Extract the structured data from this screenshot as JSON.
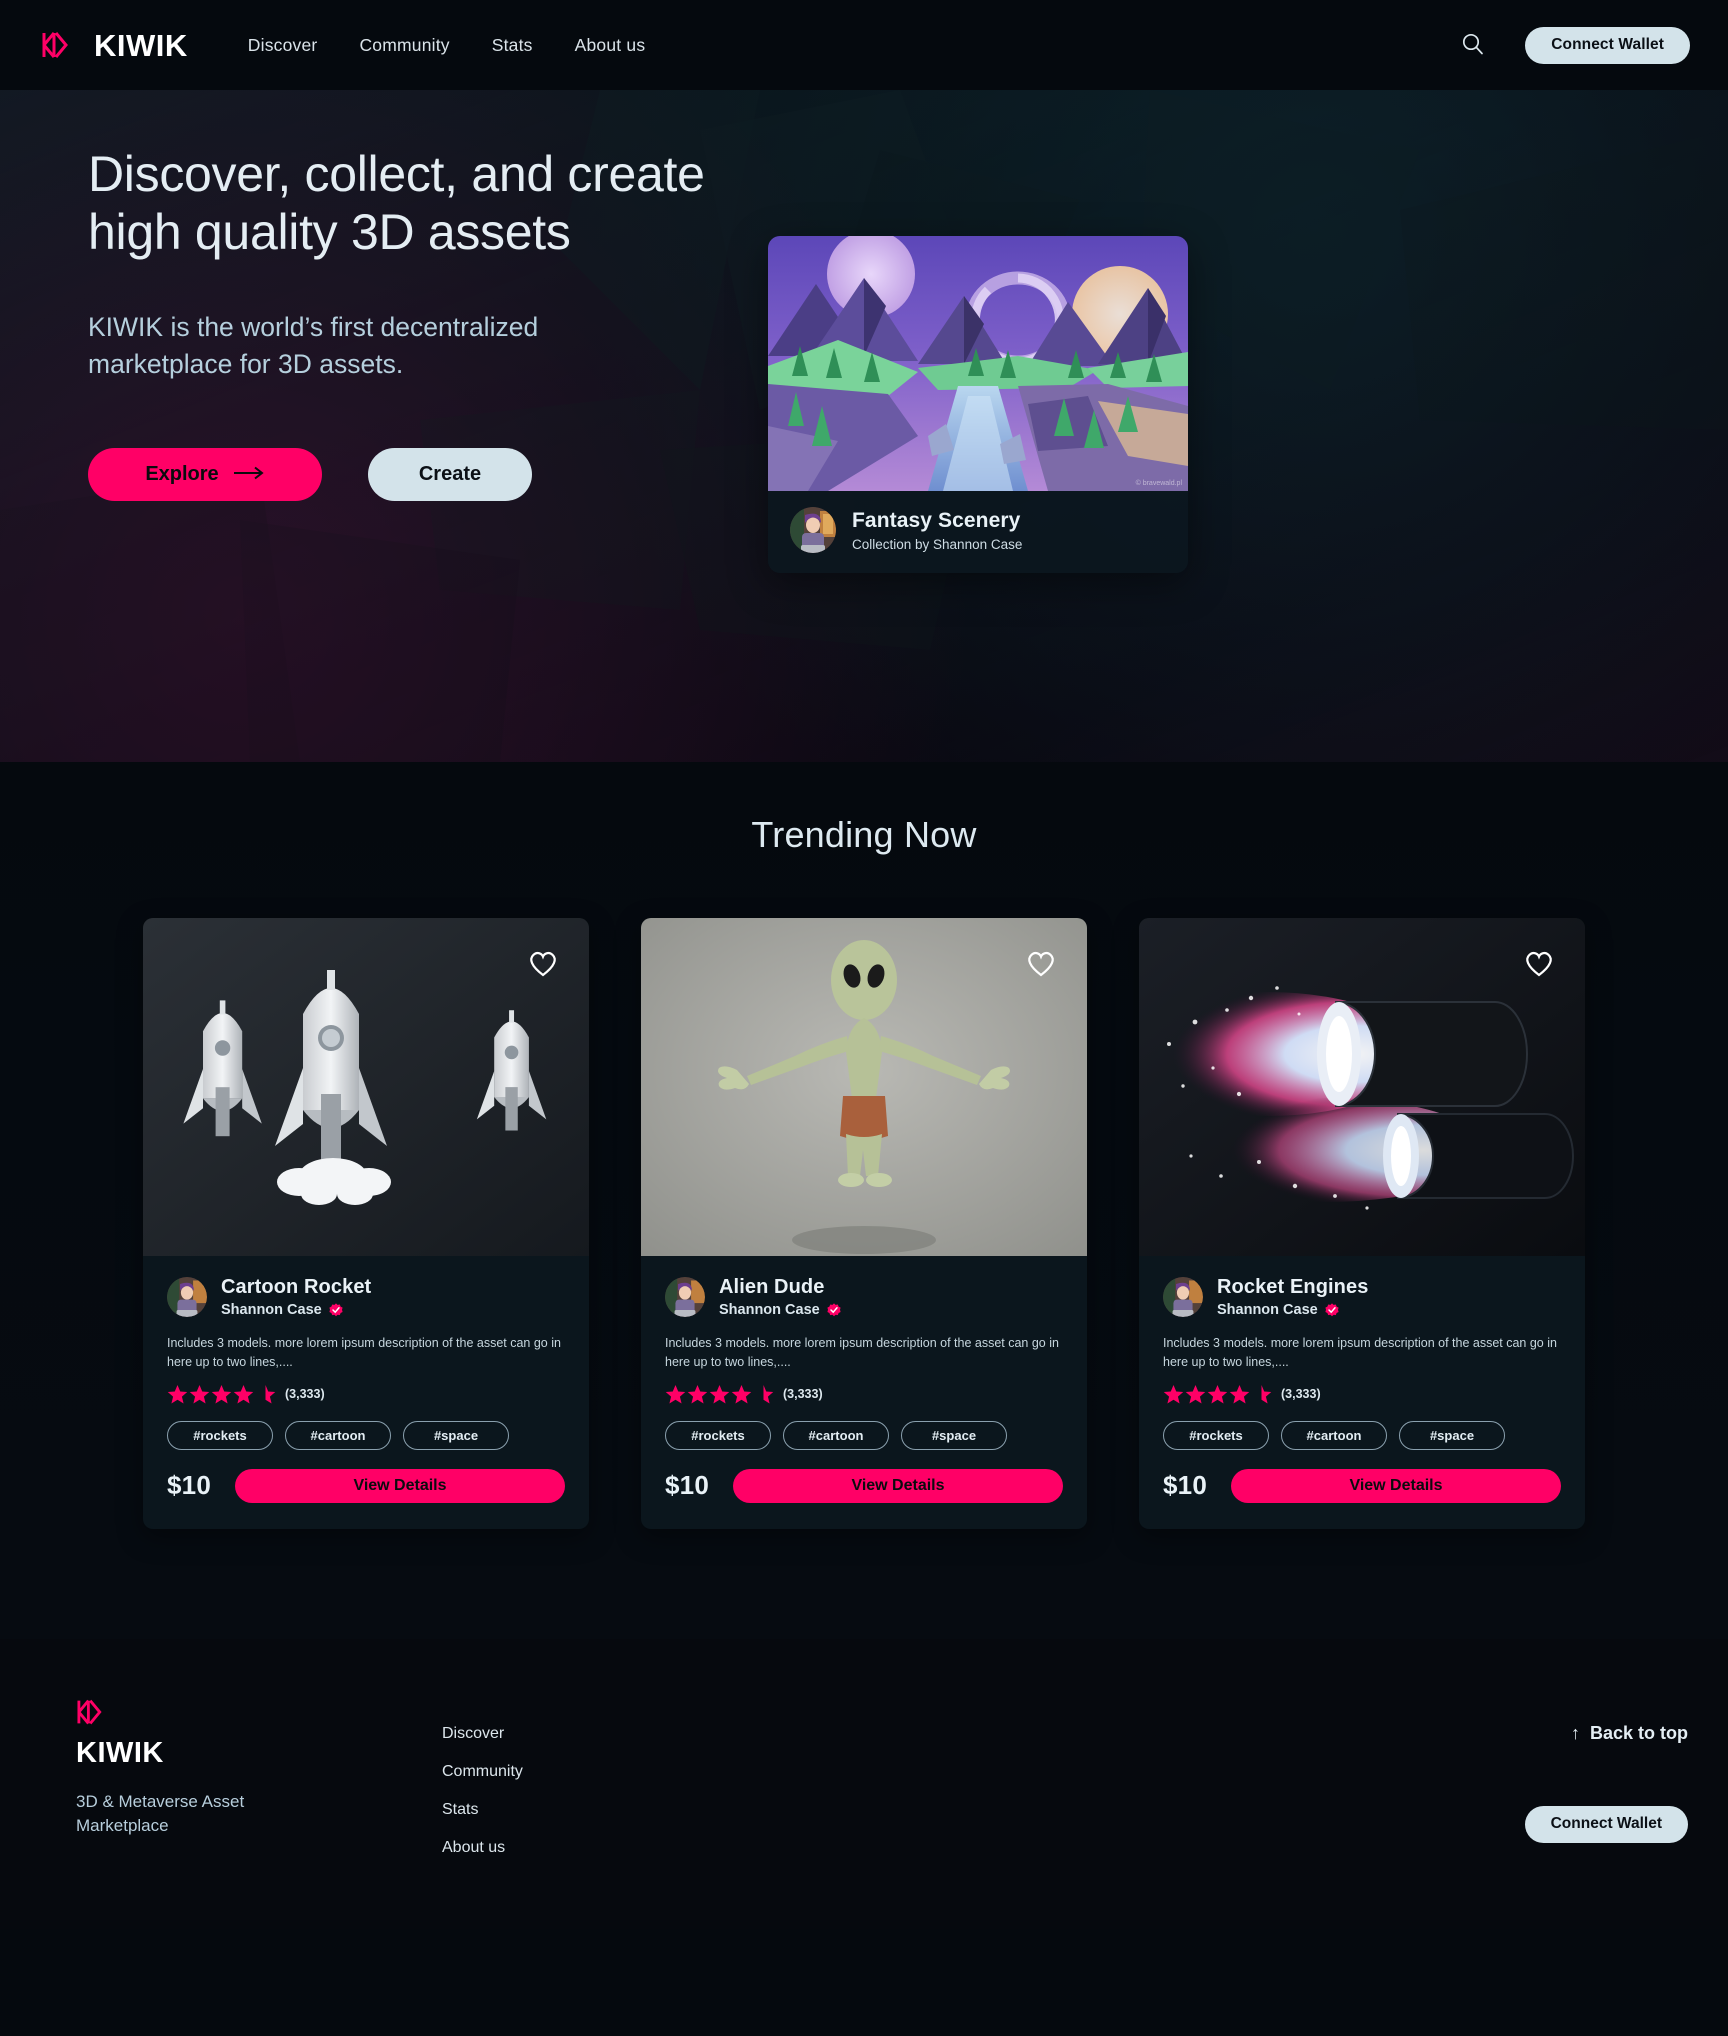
{
  "header": {
    "logo_word": "KIWIK",
    "logo_icon": "kiwik-logo-icon",
    "nav": [
      {
        "label": "Discover"
      },
      {
        "label": "Community"
      },
      {
        "label": "Stats"
      },
      {
        "label": "About us"
      }
    ],
    "search_icon": "search-icon",
    "wallet_label": "Connect Wallet"
  },
  "hero": {
    "title": "Discover, collect, and create high quality 3D assets",
    "subtitle": "KIWIK is the world’s first decentralized marketplace for 3D assets.",
    "primary_cta": "Explore",
    "primary_cta_arrow": "→",
    "secondary_cta": "Create",
    "feature": {
      "image_name": "fantasy-low-poly-landscape",
      "watermark": "© bravewald.pl",
      "title": "Fantasy Scenery",
      "subtitle": "Collection by Shannon Case",
      "avatar_name": "shannon-case-avatar"
    }
  },
  "trending": {
    "title": "Trending Now",
    "cards": [
      {
        "image_name": "cartoon-rocket-render",
        "title": "Cartoon Rocket",
        "author": "Shannon Case",
        "verified": true,
        "description": "Includes 3 models. more lorem ipsum description of the asset can go in here up to two lines,....",
        "rating": 4.5,
        "rating_count": "(3,333)",
        "tags": [
          "#rockets",
          "#cartoon",
          "#space"
        ],
        "price": "$10",
        "cta": "View Details",
        "like_icon": "heart-icon"
      },
      {
        "image_name": "alien-dude-render",
        "title": "Alien Dude",
        "author": "Shannon Case",
        "verified": true,
        "description": "Includes 3 models. more lorem ipsum description of the asset can go in here up to two lines,....",
        "rating": 4.5,
        "rating_count": "(3,333)",
        "tags": [
          "#rockets",
          "#cartoon",
          "#space"
        ],
        "price": "$10",
        "cta": "View Details",
        "like_icon": "heart-icon"
      },
      {
        "image_name": "rocket-engines-render",
        "title": "Rocket Engines",
        "author": "Shannon Case",
        "verified": true,
        "description": "Includes 3 models. more lorem ipsum description of the asset can go in here up to two lines,....",
        "rating": 4.5,
        "rating_count": "(3,333)",
        "tags": [
          "#rockets",
          "#cartoon",
          "#space"
        ],
        "price": "$10",
        "cta": "View Details",
        "like_icon": "heart-icon"
      }
    ]
  },
  "footer": {
    "logo_word": "KIWIK",
    "tagline": "3D & Metaverse Asset Marketplace",
    "nav": [
      {
        "label": "Discover"
      },
      {
        "label": "Community"
      },
      {
        "label": "Stats"
      },
      {
        "label": "About us"
      }
    ],
    "back_to_top": "Back to top",
    "back_to_top_arrow": "↑",
    "wallet_label": "Connect Wallet"
  },
  "colors": {
    "accent_pink": "#ff0066",
    "light_button": "#d3e3ea",
    "page_bg": "#05090e",
    "card_bg": "#0b161d",
    "text_primary": "#e4edf3",
    "text_muted": "#b5cfdd"
  }
}
